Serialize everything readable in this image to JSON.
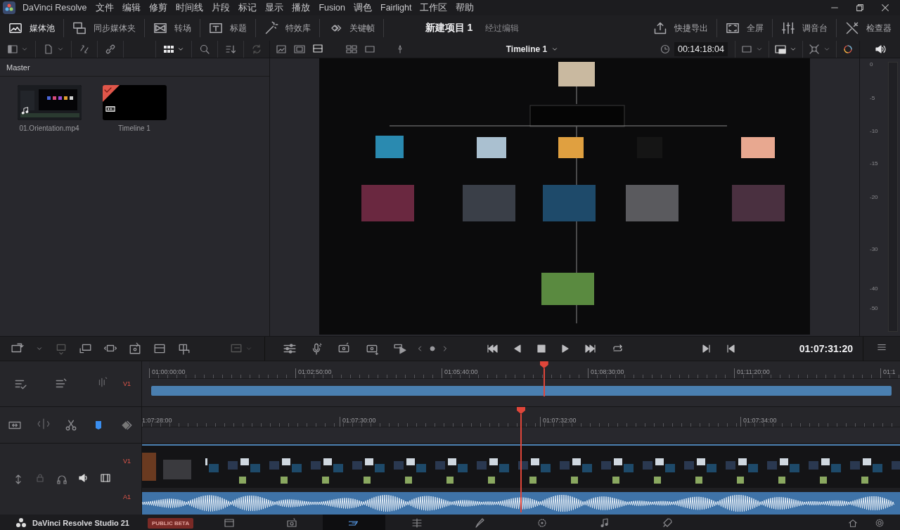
{
  "app": {
    "name": "DaVinci Resolve"
  },
  "menu": [
    "文件",
    "编辑",
    "修剪",
    "时间线",
    "片段",
    "标记",
    "显示",
    "播放",
    "Fusion",
    "调色",
    "Fairlight",
    "工作区",
    "帮助"
  ],
  "toolbar": {
    "left": [
      {
        "label": "媒体池",
        "selected": true
      },
      {
        "label": "同步媒体夹",
        "selected": false
      },
      {
        "label": "转场",
        "selected": false
      },
      {
        "label": "标题",
        "selected": false
      },
      {
        "label": "特效库",
        "selected": false
      },
      {
        "label": "关键帧",
        "selected": false
      }
    ],
    "project_title": "新建项目 1",
    "project_status": "经过编辑",
    "right": [
      {
        "label": "快捷导出"
      },
      {
        "label": "全屏"
      },
      {
        "label": "调音台"
      },
      {
        "label": "检查器"
      }
    ]
  },
  "media_pool": {
    "bin": "Master",
    "clips": [
      {
        "name": "01.Orientation.mp4",
        "kind": "video"
      },
      {
        "name": "Timeline 1",
        "kind": "timeline"
      }
    ]
  },
  "viewer": {
    "timeline_name": "Timeline 1",
    "timecode": "00:14:18:04"
  },
  "audio_meter": {
    "ticks": [
      "0",
      "-5",
      "-10",
      "-15",
      "-20",
      "-30",
      "-40",
      "-50"
    ]
  },
  "transport": {
    "timecode": "01:07:31:20"
  },
  "timeline": {
    "upper_ruler": [
      "01:00:00:00",
      "01:02:50:00",
      "01:05:40:00",
      "01:08:30:00",
      "01:11:20:00",
      "01:1"
    ],
    "upper_track": "V1",
    "upper_playhead": {
      "level": 0.526
    },
    "lower_ruler": [
      "1:07:28:00",
      "01:07:30:00",
      "01:07:32:00",
      "01:07:34:00"
    ],
    "tracks": [
      {
        "name": "V1",
        "kind": "video"
      },
      {
        "name": "A1",
        "kind": "audio"
      }
    ]
  },
  "pagebar": {
    "product": "DaVinci Resolve Studio 21",
    "badge": "PUBLIC BETA",
    "pages": [
      {
        "selected": false
      },
      {
        "selected": false
      },
      {
        "selected": true
      },
      {
        "selected": false
      },
      {
        "selected": false
      },
      {
        "selected": false
      },
      {
        "selected": false
      },
      {
        "selected": false
      }
    ]
  }
}
